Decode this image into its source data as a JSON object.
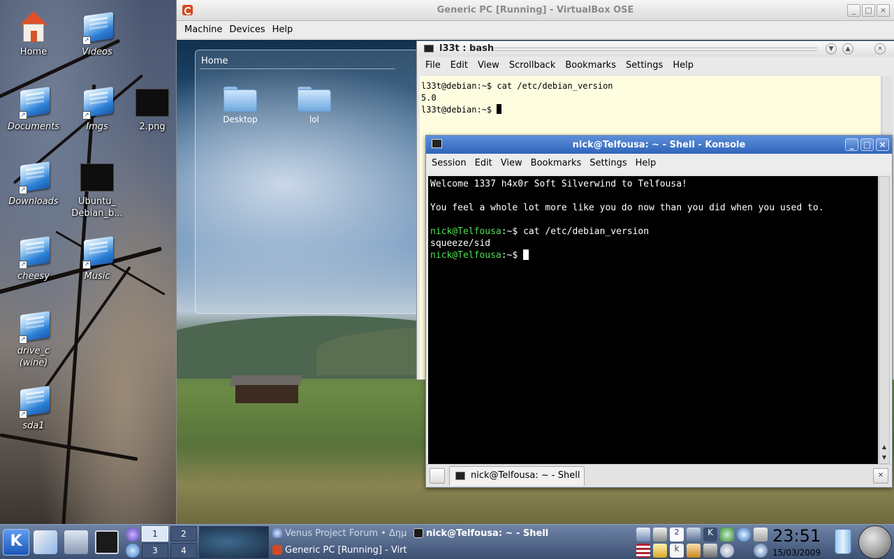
{
  "host_desktop": {
    "icons": [
      {
        "label": "Home",
        "icon": "home-icon"
      },
      {
        "label": "Videos",
        "icon": "folder-link-icon"
      },
      {
        "label": "Documents",
        "icon": "folder-link-icon"
      },
      {
        "label": "Imgs",
        "icon": "folder-link-icon"
      },
      {
        "label": "2.png",
        "icon": "image-file-icon"
      },
      {
        "label": "Downloads",
        "icon": "folder-link-icon"
      },
      {
        "label": "Ubuntu_ Debian_b...",
        "icon": "image-file-icon"
      },
      {
        "label": "cheesy",
        "icon": "folder-link-icon"
      },
      {
        "label": "Music",
        "icon": "folder-link-icon"
      },
      {
        "label": "drive_c (wine)",
        "icon": "folder-link-icon"
      },
      {
        "label": "sda1",
        "icon": "folder-link-icon"
      }
    ]
  },
  "vbox": {
    "title": "Generic PC [Running] - VirtualBox OSE",
    "menu": [
      "Machine",
      "Devices",
      "Help"
    ],
    "window_buttons": [
      "_",
      "□",
      "×"
    ],
    "guest": {
      "home_window": {
        "title": "Home",
        "folders": [
          "Desktop",
          "lol"
        ]
      },
      "konsole": {
        "title": "l33t : bash",
        "menu": [
          "File",
          "Edit",
          "View",
          "Scrollback",
          "Bookmarks",
          "Settings",
          "Help"
        ],
        "lines": [
          "l33t@debian:~$ cat /etc/debian_version",
          "5.0",
          "l33t@debian:~$ "
        ]
      }
    }
  },
  "konsole": {
    "title": "nick@Telfousa: ~ - Shell - Konsole",
    "menu": [
      "Session",
      "Edit",
      "View",
      "Bookmarks",
      "Settings",
      "Help"
    ],
    "window_buttons": [
      "_",
      "□",
      "×"
    ],
    "output": {
      "welcome": "Welcome 1337 h4x0r Soft Silverwind to Telfousa!",
      "message": "You feel a whole lot more like you do now than you did when you used to.",
      "prompt_user": "nick@Telfousa",
      "prompt_path": ":~",
      "prompt_symbol": "$ ",
      "command": "cat /etc/debian_version",
      "result": "squeeze/sid"
    },
    "tab_label": "nick@Telfousa: ~ - Shell"
  },
  "taskbar": {
    "kmenu_label": "K",
    "pager": [
      "1",
      "2",
      "3",
      "4"
    ],
    "tasks": [
      {
        "label": "Venus Project Forum • Δημ",
        "active": false
      },
      {
        "label": "nick@Telfousa: ~ - Shell",
        "active": true
      },
      {
        "label": "Generic PC [Running] - Virt",
        "active": false
      }
    ],
    "clock_time": "23:51",
    "clock_date": "15/03/2009"
  },
  "colors": {
    "prompt_green": "#4ee04e",
    "titlebar_blue": "#2f64bb",
    "vbox_accent": "#d24a23"
  }
}
